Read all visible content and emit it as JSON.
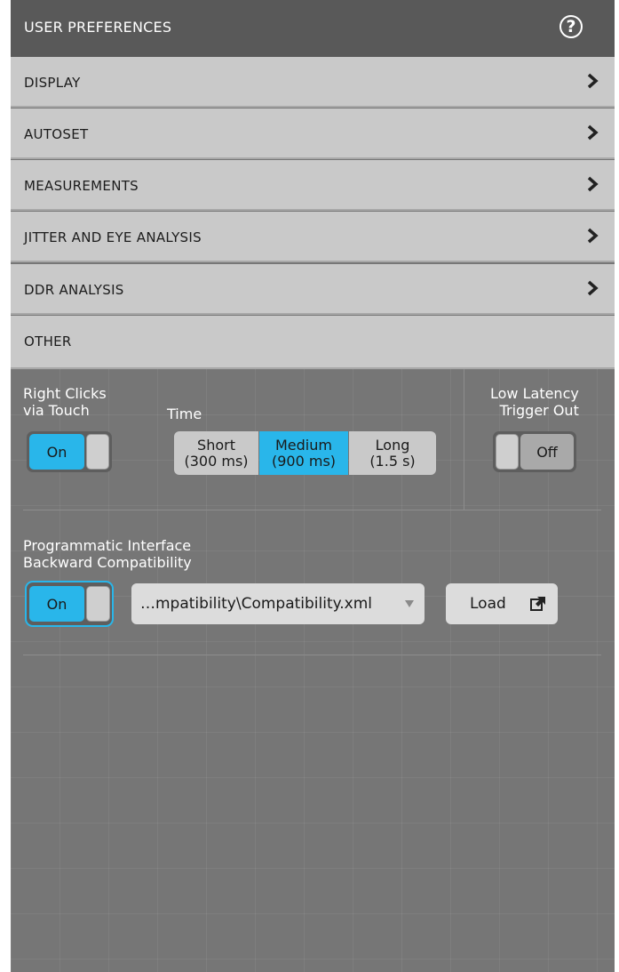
{
  "header": {
    "title": "USER PREFERENCES"
  },
  "sections": [
    {
      "label": "DISPLAY"
    },
    {
      "label": "AUTOSET"
    },
    {
      "label": "MEASUREMENTS"
    },
    {
      "label": "JITTER AND EYE ANALYSIS"
    },
    {
      "label": "DDR ANALYSIS"
    },
    {
      "label": "OTHER"
    }
  ],
  "other": {
    "right_clicks": {
      "label_line1": "Right Clicks",
      "label_line2": "via Touch",
      "state": "On"
    },
    "time": {
      "label": "Time",
      "options": [
        {
          "line1": "Short",
          "line2": "(300 ms)"
        },
        {
          "line1": "Medium",
          "line2": "(900 ms)"
        },
        {
          "line1": "Long",
          "line2": "(1.5 s)"
        }
      ],
      "selected": "Medium"
    },
    "low_latency": {
      "label_line1": "Low Latency",
      "label_line2": "Trigger Out",
      "state": "Off"
    },
    "prog_interface": {
      "label_line1": "Programmatic Interface",
      "label_line2": "Backward Compatibility",
      "state": "On",
      "file_value": "…mpatibility\\Compatibility.xml",
      "load_label": "Load"
    }
  },
  "colors": {
    "accent": "#29b6ea",
    "panel": "#767676",
    "section": "#c9c9c9"
  }
}
